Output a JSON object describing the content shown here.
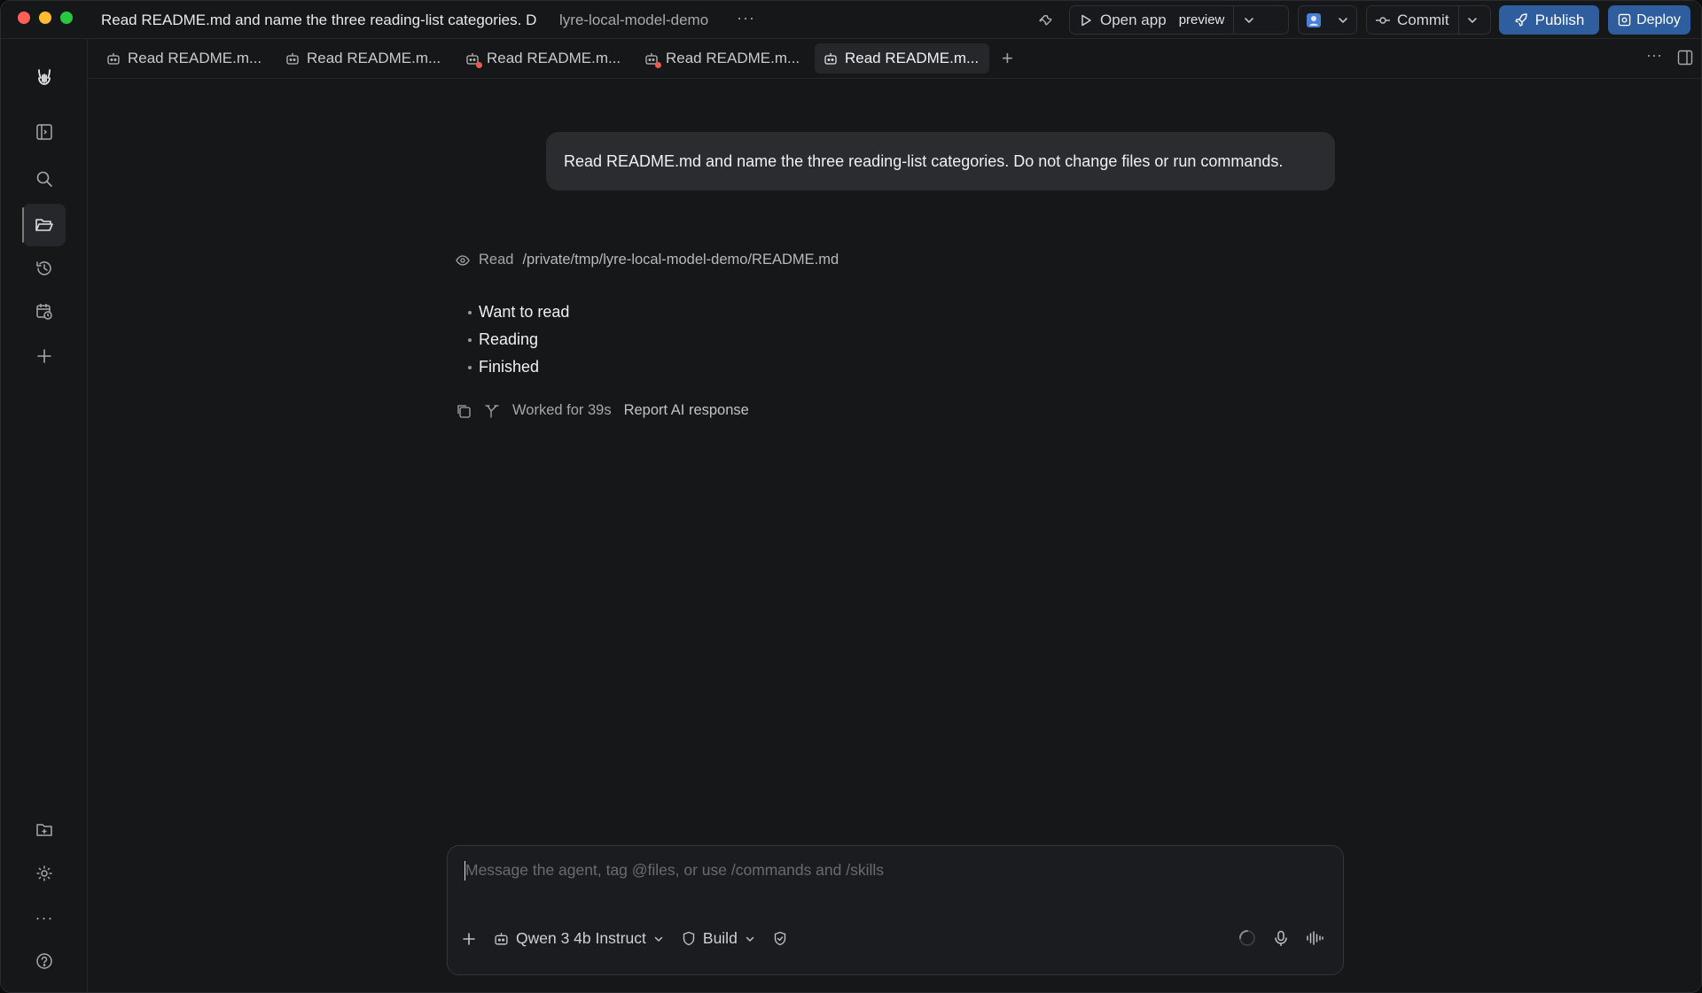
{
  "window": {
    "title": "Read README.md and name the three reading-list categories. D",
    "project": "lyre-local-model-demo",
    "more_label": "···"
  },
  "toolbar": {
    "open_app_label": "Open app",
    "preview_label": "preview",
    "commit_label": "Commit",
    "publish_label": "Publish",
    "deploy_label": "Deploy"
  },
  "tabs": [
    {
      "label": "Read README.m...",
      "has_alert": false,
      "active": false
    },
    {
      "label": "Read README.m...",
      "has_alert": false,
      "active": false
    },
    {
      "label": "Read README.m...",
      "has_alert": true,
      "active": false
    },
    {
      "label": "Read README.m...",
      "has_alert": true,
      "active": false
    },
    {
      "label": "Read README.m...",
      "has_alert": false,
      "active": true
    }
  ],
  "tab_add_label": "+",
  "tab_more_label": "···",
  "rail": {
    "top_icons": [
      "lyre-logo-icon",
      "sidebar-toggle-icon",
      "search-icon",
      "folder-open-icon",
      "history-icon",
      "calendar-clock-icon",
      "plus-icon"
    ],
    "bottom_icons": [
      "folder-plus-icon",
      "gear-icon",
      "more-icon",
      "help-icon"
    ],
    "active_item": "folder-open-icon",
    "more_label": "···"
  },
  "conversation": {
    "user_message": "Read README.md and name the three reading-list categories. Do not change files or run commands.",
    "tool_call": {
      "verb": "Read",
      "path": "/private/tmp/lyre-local-model-demo/README.md"
    },
    "answer_items": [
      "Want to read",
      "Reading",
      "Finished"
    ],
    "worked_for": "Worked for 39s",
    "report_label": "Report AI response"
  },
  "composer": {
    "placeholder": "Message the agent, tag @files, or use /commands and /skills",
    "model": "Qwen 3 4b Instruct",
    "mode": "Build"
  },
  "colors": {
    "accent_blue": "#2f5e9e",
    "alert_dot": "#f0584d",
    "background": "#161719"
  }
}
